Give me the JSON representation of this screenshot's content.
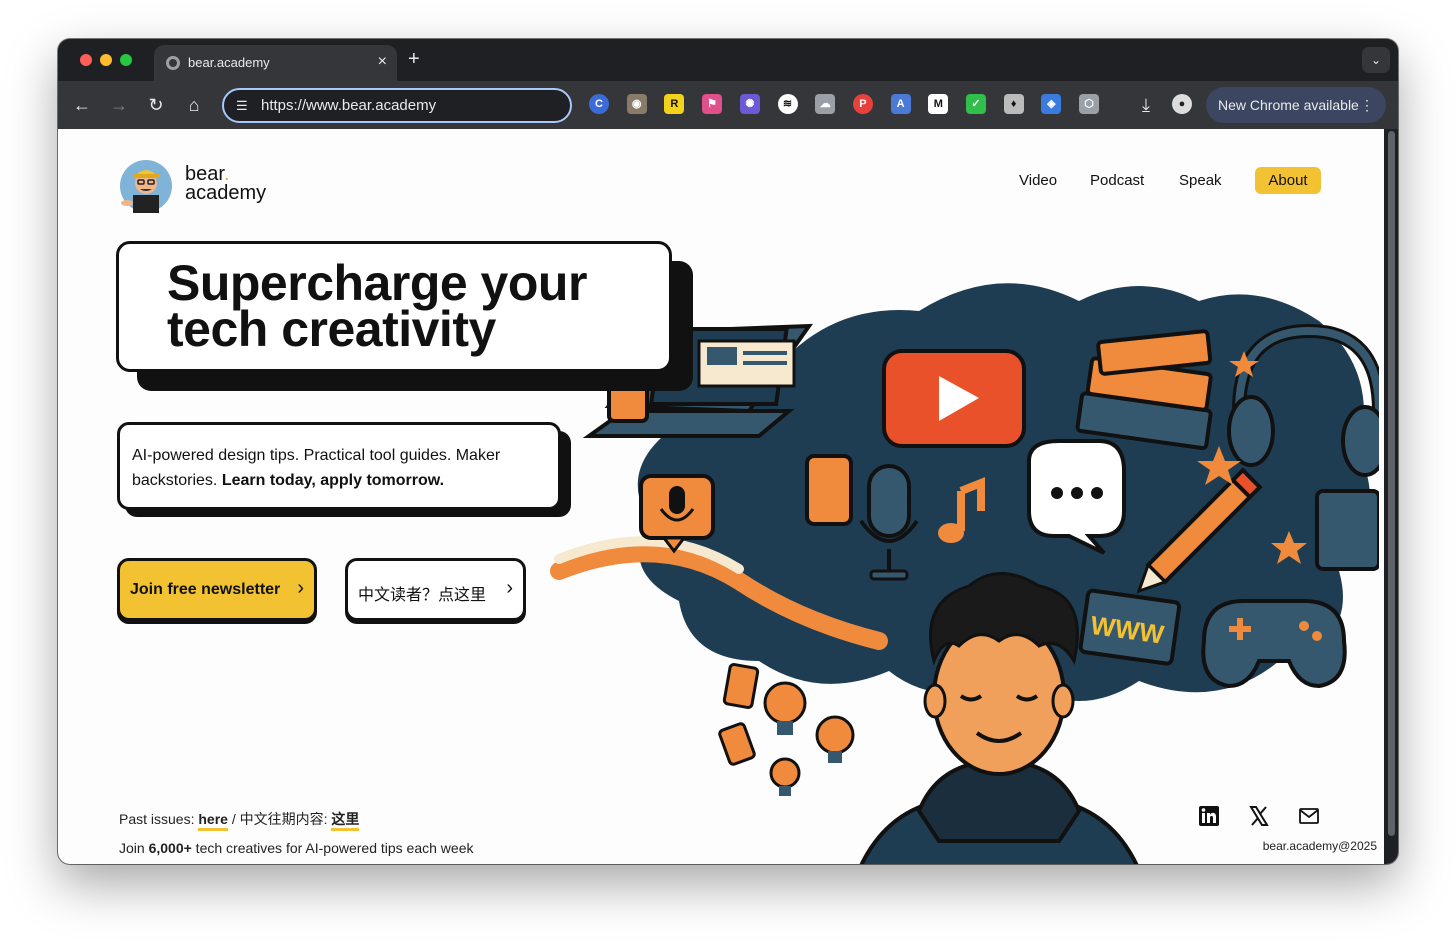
{
  "browser": {
    "tab_title": "bear.academy",
    "tab_close": "×",
    "new_tab": "+",
    "tab_menu": "⌄",
    "url": "https://www.bear.academy",
    "update_button": "New Chrome available",
    "update_menu": "⋮",
    "nav": {
      "back": "←",
      "forward": "→",
      "reload": "↻",
      "home": "⌂"
    },
    "extensions": [
      "C",
      "◉",
      "R",
      "⚑",
      "✺",
      "≋",
      "☁",
      "P",
      "A",
      "M",
      "✓",
      "♦",
      "◈",
      "⬡"
    ],
    "download": "⤓"
  },
  "site": {
    "logo_line1": "bear",
    "logo_dot": ".",
    "logo_line2": "academy",
    "nav": {
      "video": "Video",
      "podcast": "Podcast",
      "speak": "Speak",
      "about": "About"
    },
    "hero_title_line1": "Supercharge your",
    "hero_title_line2": "tech creativity",
    "subtitle_plain": "AI-powered design tips. Practical tool guides. Maker backstories. ",
    "subtitle_bold": "Learn today, apply tomorrow.",
    "cta_primary": "Join free newsletter",
    "cta_secondary": "中文读者？点这里",
    "cta_chevron": "›",
    "illustration_label": "WWW",
    "footer": {
      "past_issues_prefix": "Past issues: ",
      "past_issues_link": "here",
      "separator": " / ",
      "cn_prefix": "中文往期内容: ",
      "cn_link": "这里",
      "join_prefix": "Join ",
      "join_count": "6,000+",
      "join_suffix": " tech creatives for AI-powered tips each week",
      "copyright": "bear.academy@2025"
    }
  },
  "colors": {
    "accent_yellow": "#f2c233",
    "navy": "#1f3d52",
    "orange": "#f08a3c",
    "red": "#e8512a"
  }
}
